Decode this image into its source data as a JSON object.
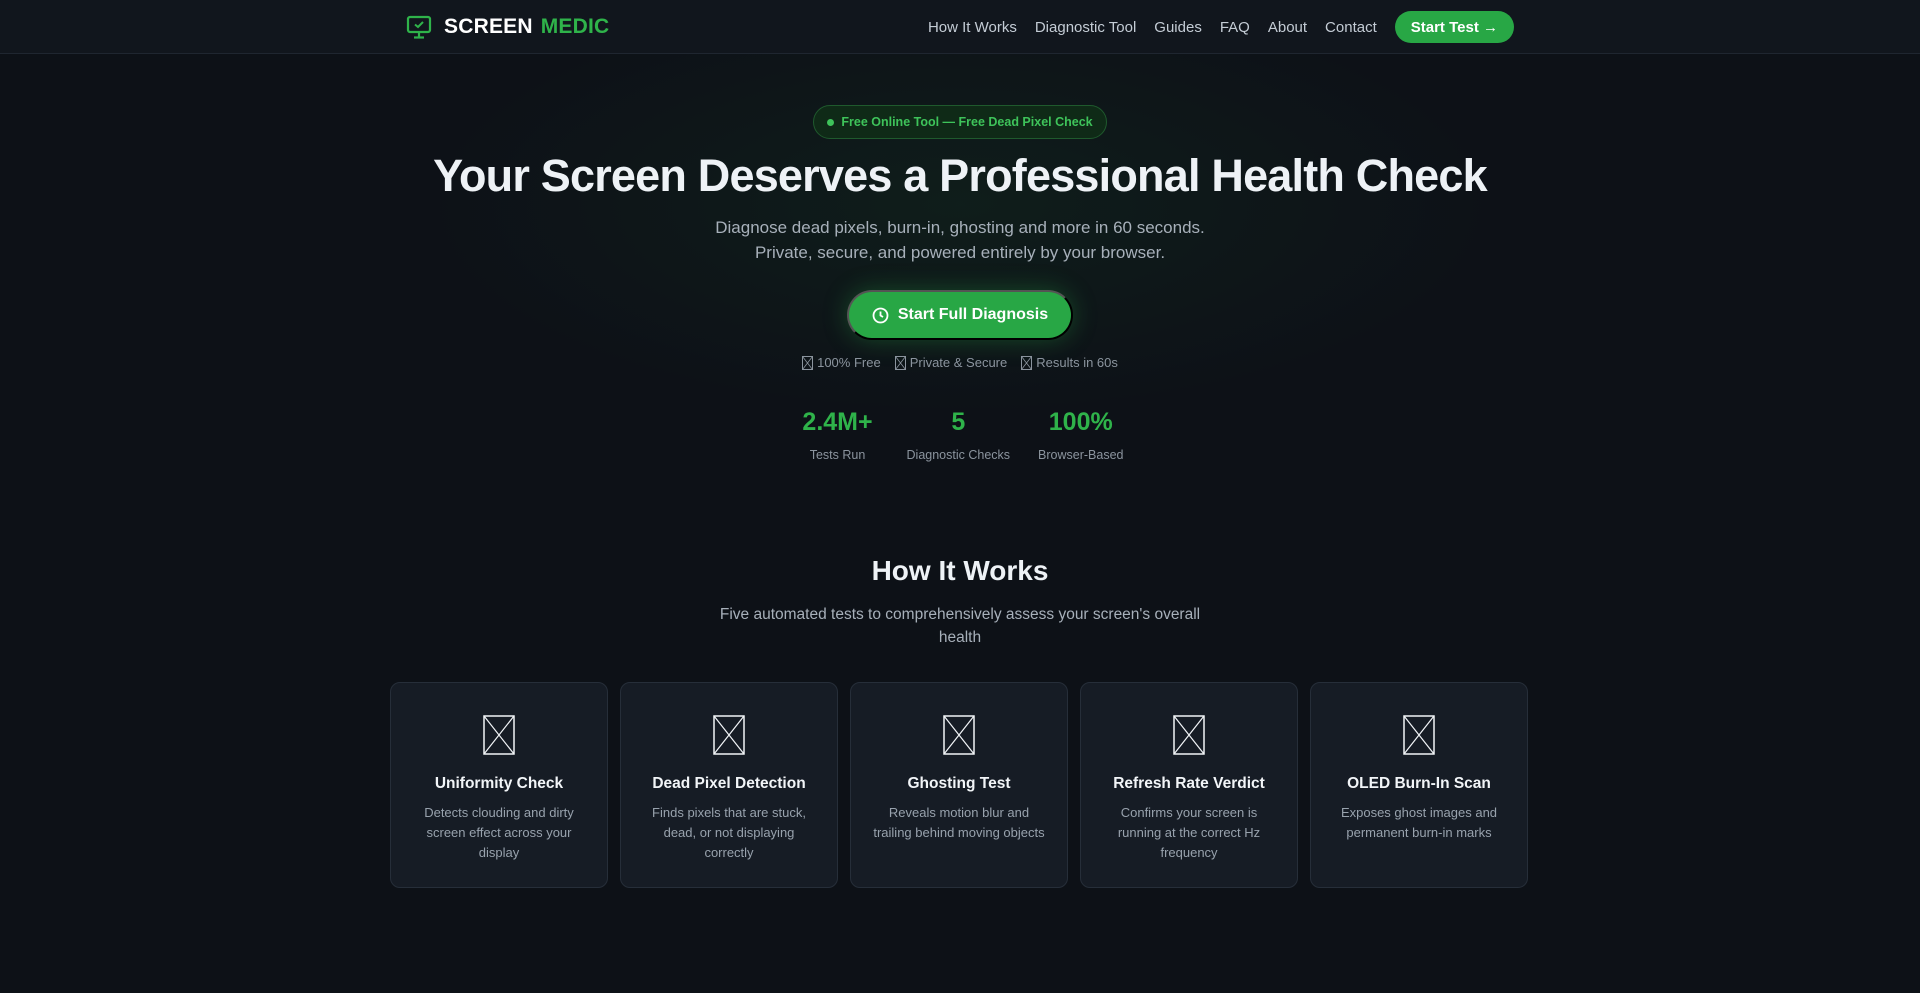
{
  "brand": {
    "part1": "SCREEN",
    "part2": "MEDIC",
    "accent_color": "#2fb34a",
    "icon": "monitor-icon"
  },
  "nav": {
    "links": [
      "How It Works",
      "Diagnostic Tool",
      "Guides",
      "FAQ",
      "About",
      "Contact"
    ],
    "cta_label": "Start Test →"
  },
  "hero": {
    "badge": "Free Online Tool — Free Dead Pixel Check",
    "title": "Your Screen Deserves a Professional Health Check",
    "subtitle_line1": "Diagnose dead pixels, burn-in, ghosting and more in 60 seconds.",
    "subtitle_line2": "Private, secure, and powered entirely by your browser.",
    "cta_label": "Start Full Diagnosis",
    "trust": [
      "100% Free",
      "Private & Secure",
      "Results in 60s"
    ]
  },
  "stats": [
    {
      "value": "2.4M+",
      "label": "Tests Run"
    },
    {
      "value": "5",
      "label": "Diagnostic Checks"
    },
    {
      "value": "100%",
      "label": "Browser-Based"
    }
  ],
  "how_it_works": {
    "title": "How It Works",
    "subtitle": "Five automated tests to comprehensively assess your screen's overall health",
    "cards": [
      {
        "title": "Uniformity Check",
        "desc": "Detects clouding and dirty screen effect across your display"
      },
      {
        "title": "Dead Pixel Detection",
        "desc": "Finds pixels that are stuck, dead, or not displaying correctly"
      },
      {
        "title": "Ghosting Test",
        "desc": "Reveals motion blur and trailing behind moving objects"
      },
      {
        "title": "Refresh Rate Verdict",
        "desc": "Confirms your screen is running at the correct Hz frequency"
      },
      {
        "title": "OLED Burn-In Scan",
        "desc": "Exposes ghost images and permanent burn-in marks"
      }
    ]
  }
}
